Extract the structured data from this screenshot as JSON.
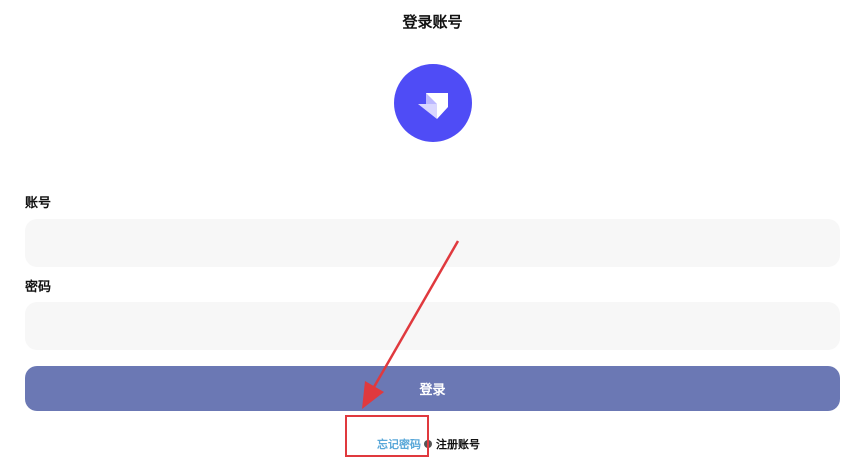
{
  "page": {
    "title": "登录账号",
    "logo_icon": "app-logo-icon",
    "accent_color": "#4f4cf6"
  },
  "form": {
    "account_label": "账号",
    "account_value": "",
    "password_label": "密码",
    "password_value": "",
    "login_button": "登录",
    "login_button_color": "#6b78b4"
  },
  "links": {
    "forgot_password": "忘记密码",
    "register": "注册账号"
  },
  "annotation": {
    "color": "#e0393e"
  }
}
